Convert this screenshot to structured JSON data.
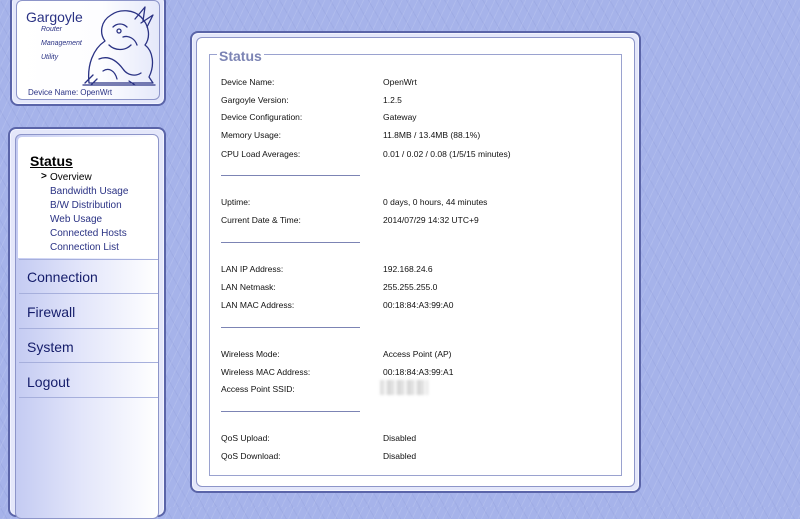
{
  "logo": {
    "title": "Gargoyle",
    "subtitle": [
      "Router",
      "Management",
      "Utility"
    ],
    "device_label": "Device Name:",
    "device_name": "OpenWrt"
  },
  "nav": {
    "status_title": "Status",
    "status_items": [
      {
        "label": "Overview",
        "selected": true
      },
      {
        "label": "Bandwidth Usage"
      },
      {
        "label": "B/W Distribution"
      },
      {
        "label": "Web Usage"
      },
      {
        "label": "Connected Hosts"
      },
      {
        "label": "Connection List"
      }
    ],
    "sections": [
      "Connection",
      "Firewall",
      "System",
      "Logout"
    ]
  },
  "status": {
    "legend": "Status",
    "rows": [
      {
        "label": "Device Name:",
        "value": "OpenWrt"
      },
      {
        "label": "Gargoyle Version:",
        "value": "1.2.5"
      },
      {
        "label": "Device Configuration:",
        "value": "Gateway"
      },
      {
        "label": "Memory Usage:",
        "value": "11.8MB / 13.4MB (88.1%)"
      },
      {
        "label": "CPU Load Averages:",
        "value": "0.01 / 0.02 / 0.08  (1/5/15 minutes)"
      },
      {
        "label": "Uptime:",
        "value": "0 days, 0 hours, 44 minutes"
      },
      {
        "label": "Current Date & Time:",
        "value": "2014/07/29 14:32 UTC+9"
      },
      {
        "label": "LAN IP Address:",
        "value": "192.168.24.6"
      },
      {
        "label": "LAN Netmask:",
        "value": "255.255.255.0"
      },
      {
        "label": "LAN MAC Address:",
        "value": "00:18:84:A3:99:A0"
      },
      {
        "label": "Wireless Mode:",
        "value": "Access Point (AP)"
      },
      {
        "label": "Wireless MAC Address:",
        "value": "00:18:84:A3:99:A1"
      },
      {
        "label": "Access Point SSID:",
        "value": ""
      },
      {
        "label": "QoS Upload:",
        "value": "Disabled"
      },
      {
        "label": "QoS Download:",
        "value": "Disabled"
      }
    ]
  },
  "colors": {
    "background": "#a6b3ea",
    "panel_border": "#5a64a8",
    "link": "#2a3284",
    "legend": "#7c84b4"
  }
}
